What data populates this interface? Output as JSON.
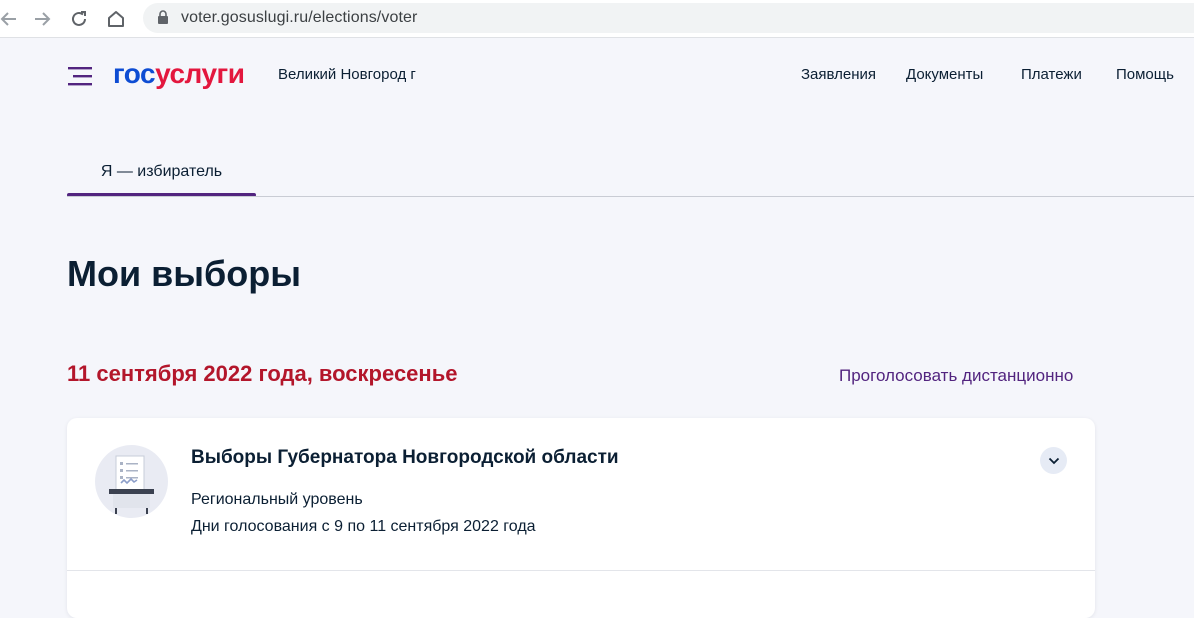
{
  "browser": {
    "url": "voter.gosuslugi.ru/elections/voter"
  },
  "header": {
    "logo_part1": "гос",
    "logo_part2": "услуги",
    "region": "Великий Новгород г",
    "nav": [
      "Заявления",
      "Документы",
      "Платежи",
      "Помощь"
    ]
  },
  "tabs": [
    {
      "label": "Я — избиратель",
      "active": true
    }
  ],
  "main": {
    "title": "Мои выборы",
    "date_heading": "11 сентября 2022 года, воскресенье",
    "remote_vote_link": "Проголосовать дистанционно",
    "elections": [
      {
        "title": "Выборы Губернатора Новгородской области",
        "level": "Региональный уровень",
        "voting_days": "Дни голосования с 9 по 11 сентября 2022 года"
      }
    ]
  },
  "colors": {
    "brand_blue": "#0d4cd3",
    "brand_red": "#e3173e",
    "accent_purple": "#52247f",
    "date_red": "#b3162b"
  },
  "icons": [
    "back-arrow-icon",
    "forward-arrow-icon",
    "reload-icon",
    "home-icon",
    "lock-icon",
    "menu-icon",
    "ballot-box-icon",
    "chevron-down-icon"
  ]
}
